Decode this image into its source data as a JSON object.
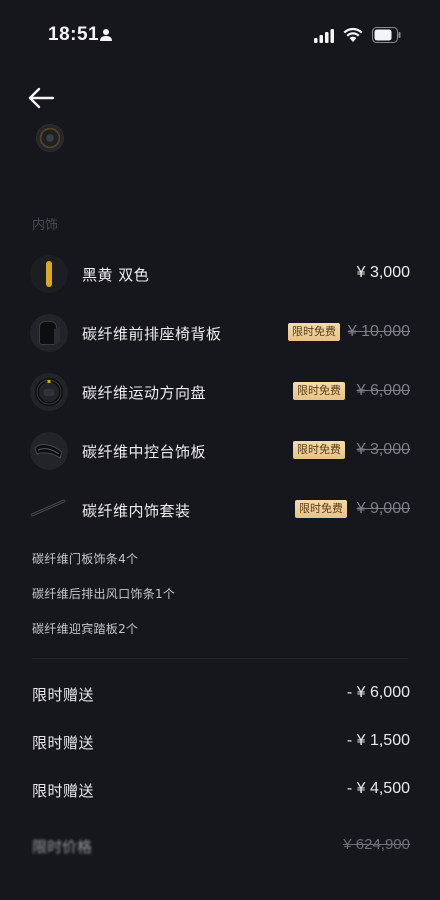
{
  "status_bar": {
    "time": "18:51"
  },
  "section": {
    "title": "内饰"
  },
  "items": [
    {
      "name": "黑黄 双色",
      "price": "¥ 3,000",
      "badge": "",
      "struck": false
    },
    {
      "name": "碳纤维前排座椅背板",
      "price": "¥ 10,000",
      "badge": "限时免费",
      "struck": true
    },
    {
      "name": "碳纤维运动方向盘",
      "price": "¥ 6,000",
      "badge": "限时免费",
      "struck": true
    },
    {
      "name": "碳纤维中控台饰板",
      "price": "¥ 3,000",
      "badge": "限时免费",
      "struck": true
    },
    {
      "name": "碳纤维内饰套装",
      "price": "¥ 9,000",
      "badge": "限时免费",
      "struck": true
    }
  ],
  "sub_items": [
    "碳纤维门板饰条4个",
    "碳纤维后排出风口饰条1个",
    "碳纤维迎宾踏板2个"
  ],
  "gifts": [
    {
      "label": "限时赠送",
      "amount": "- ¥ 6,000"
    },
    {
      "label": "限时赠送",
      "amount": "- ¥ 1,500"
    },
    {
      "label": "限时赠送",
      "amount": "- ¥ 4,500"
    }
  ],
  "total": {
    "label": "限时价格",
    "amount": "¥ 624,900"
  },
  "colors": {
    "background": "#15171c",
    "badge_bg": "#f0d39f",
    "badge_text": "#5a3c14",
    "accent_yellow": "#d9a91f"
  }
}
